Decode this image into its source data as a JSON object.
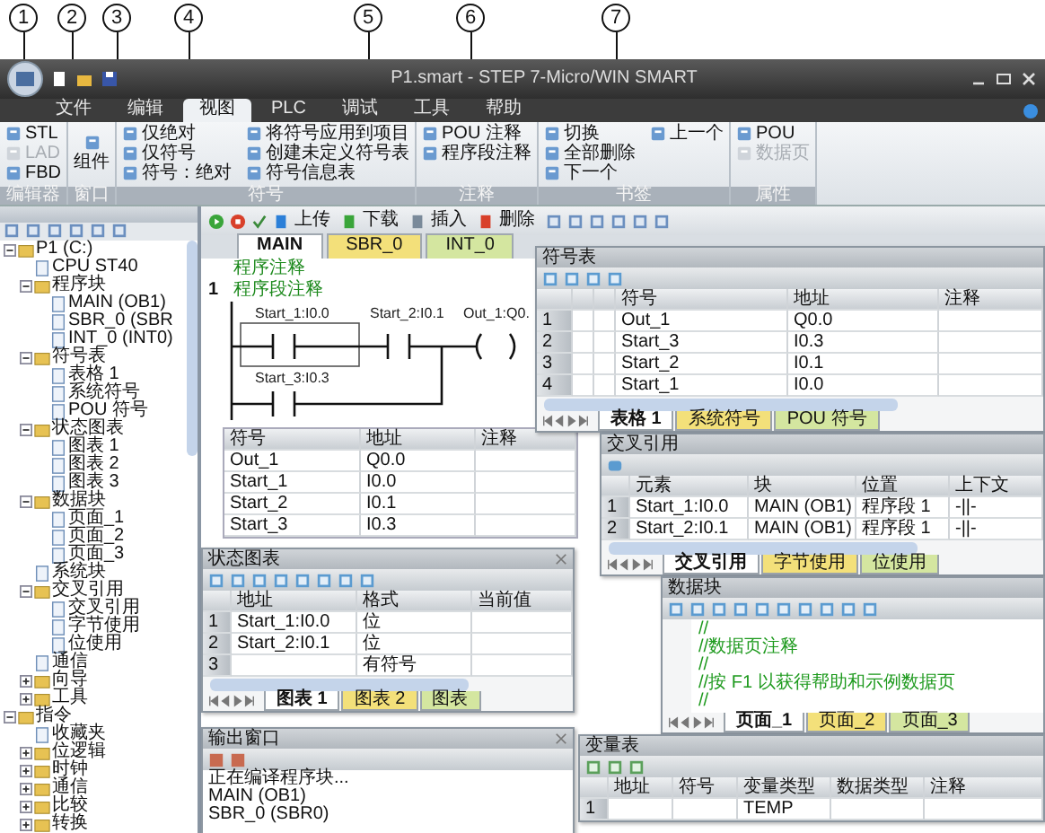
{
  "callouts": [
    "1",
    "2",
    "3",
    "4",
    "5",
    "6",
    "7"
  ],
  "window": {
    "title": "P1.smart - STEP 7-Micro/WIN SMART"
  },
  "ribbon_tabs": [
    {
      "label": "文件",
      "selected": false
    },
    {
      "label": "编辑",
      "selected": false
    },
    {
      "label": "视图",
      "selected": true
    },
    {
      "label": "PLC",
      "selected": false
    },
    {
      "label": "调试",
      "selected": false
    },
    {
      "label": "工具",
      "selected": false
    },
    {
      "label": "帮助",
      "selected": false
    }
  ],
  "ribbon_groups": [
    {
      "label": "编辑器",
      "items": [
        {
          "label": "STL",
          "disabled": false
        },
        {
          "label": "LAD",
          "disabled": true
        },
        {
          "label": "FBD",
          "disabled": false
        }
      ]
    },
    {
      "label": "窗口",
      "items": [
        {
          "label": "组件",
          "disabled": false
        }
      ]
    },
    {
      "label": "符号",
      "items": [
        {
          "label": "仅绝对",
          "disabled": false
        },
        {
          "label": "仅符号",
          "disabled": false
        },
        {
          "label": "符号：绝对",
          "disabled": false
        },
        {
          "label": "将符号应用到项目",
          "disabled": false
        },
        {
          "label": "创建未定义符号表",
          "disabled": false
        },
        {
          "label": "符号信息表",
          "disabled": false
        }
      ]
    },
    {
      "label": "注释",
      "items": [
        {
          "label": "POU 注释",
          "disabled": false
        },
        {
          "label": "程序段注释",
          "disabled": false
        }
      ]
    },
    {
      "label": "书签",
      "items": [
        {
          "label": "切换",
          "disabled": false
        },
        {
          "label": "全部删除",
          "disabled": false
        },
        {
          "label": "下一个",
          "disabled": false
        },
        {
          "label": "上一个",
          "disabled": false
        }
      ]
    },
    {
      "label": "属性",
      "items": [
        {
          "label": "POU",
          "disabled": false
        },
        {
          "label": "数据页",
          "disabled": true
        }
      ]
    }
  ],
  "tree": [
    {
      "label": "P1 (C:)",
      "expanded": true,
      "children": [
        {
          "label": "CPU ST40"
        },
        {
          "label": "程序块",
          "expanded": true,
          "children": [
            {
              "label": "MAIN (OB1)"
            },
            {
              "label": "SBR_0 (SBR"
            },
            {
              "label": "INT_0 (INT0)"
            }
          ]
        },
        {
          "label": "符号表",
          "expanded": true,
          "children": [
            {
              "label": "表格 1"
            },
            {
              "label": "系统符号"
            },
            {
              "label": "POU 符号"
            }
          ]
        },
        {
          "label": "状态图表",
          "expanded": true,
          "children": [
            {
              "label": "图表 1"
            },
            {
              "label": "图表 2"
            },
            {
              "label": "图表 3"
            }
          ]
        },
        {
          "label": "数据块",
          "expanded": true,
          "children": [
            {
              "label": "页面_1"
            },
            {
              "label": "页面_2"
            },
            {
              "label": "页面_3"
            }
          ]
        },
        {
          "label": "系统块"
        },
        {
          "label": "交叉引用",
          "expanded": true,
          "children": [
            {
              "label": "交叉引用"
            },
            {
              "label": "字节使用"
            },
            {
              "label": "位使用"
            }
          ]
        },
        {
          "label": "通信"
        },
        {
          "label": "向导",
          "expanded": false
        },
        {
          "label": "工具",
          "expanded": false
        }
      ]
    },
    {
      "label": "指令",
      "expanded": true,
      "children": [
        {
          "label": "收藏夹"
        },
        {
          "label": "位逻辑",
          "expanded": false
        },
        {
          "label": "时钟",
          "expanded": false
        },
        {
          "label": "通信",
          "expanded": false
        },
        {
          "label": "比较",
          "expanded": false
        },
        {
          "label": "转换",
          "expanded": false
        }
      ]
    }
  ],
  "editor": {
    "toolbar": [
      "上传",
      "下载",
      "插入",
      "删除"
    ],
    "tabs": [
      {
        "label": "MAIN",
        "selected": true,
        "color": "#ffffff"
      },
      {
        "label": "SBR_0",
        "selected": false,
        "color": "#f3e07a"
      },
      {
        "label": "INT_0",
        "selected": false,
        "color": "#d4e6a0"
      }
    ],
    "program_comment": "程序注释",
    "network": "1",
    "network_comment": "程序段注释",
    "ladder": {
      "contact_1": "Start_1:I0.0",
      "contact_2": "Start_2:I0.1",
      "coil": "Out_1:Q0.",
      "contact_3": "Start_3:I0.3"
    },
    "symbol_info": {
      "columns": [
        "符号",
        "地址",
        "注释"
      ],
      "rows": [
        {
          "symbol": "Out_1",
          "address": "Q0.0"
        },
        {
          "symbol": "Start_1",
          "address": "I0.0"
        },
        {
          "symbol": "Start_2",
          "address": "I0.1"
        },
        {
          "symbol": "Start_3",
          "address": "I0.3"
        }
      ]
    }
  },
  "symbol_table": {
    "title": "符号表",
    "columns": [
      "符号",
      "地址",
      "注释"
    ],
    "rows": [
      {
        "num": "1",
        "symbol": "Out_1",
        "address": "Q0.0"
      },
      {
        "num": "2",
        "symbol": "Start_3",
        "address": "I0.3"
      },
      {
        "num": "3",
        "symbol": "Start_2",
        "address": "I0.1"
      },
      {
        "num": "4",
        "symbol": "Start_1",
        "address": "I0.0"
      }
    ],
    "tabs": [
      {
        "label": "表格 1",
        "selected": true,
        "color": "#ffffff"
      },
      {
        "label": "系统符号",
        "selected": false,
        "color": "#f3e07a"
      },
      {
        "label": "POU 符号",
        "selected": false,
        "color": "#d4e6a0"
      }
    ]
  },
  "cross_reference": {
    "title": "交叉引用",
    "columns": [
      "元素",
      "块",
      "位置",
      "上下文"
    ],
    "rows": [
      {
        "num": "1",
        "element": "Start_1:I0.0",
        "block": "MAIN (OB1)",
        "location": "程序段 1",
        "context": "-||-"
      },
      {
        "num": "2",
        "element": "Start_2:I0.1",
        "block": "MAIN (OB1)",
        "location": "程序段 1",
        "context": "-||-"
      }
    ],
    "tabs": [
      {
        "label": "交叉引用",
        "selected": true,
        "color": "#ffffff"
      },
      {
        "label": "字节使用",
        "selected": false,
        "color": "#f3e07a"
      },
      {
        "label": "位使用",
        "selected": false,
        "color": "#d4e6a0"
      }
    ]
  },
  "status_chart": {
    "title": "状态图表",
    "columns": [
      "地址",
      "格式",
      "当前值"
    ],
    "rows": [
      {
        "num": "1",
        "address": "Start_1:I0.0",
        "format": "位"
      },
      {
        "num": "2",
        "address": "Start_2:I0.1",
        "format": "位"
      },
      {
        "num": "3",
        "format": "有符号"
      }
    ],
    "tabs": [
      {
        "label": "图表 1",
        "selected": true,
        "color": "#ffffff"
      },
      {
        "label": "图表 2",
        "selected": false,
        "color": "#f3e07a"
      },
      {
        "label": "图表",
        "selected": false,
        "color": "#d4e6a0"
      }
    ]
  },
  "output": {
    "title": "输出窗口",
    "lines": [
      "正在编译程序块...",
      "MAIN (OB1)",
      "SBR_0 (SBR0)"
    ]
  },
  "data_block": {
    "title": "数据块",
    "lines": [
      "//",
      "//数据页注释",
      "//",
      "//按 F1 以获得帮助和示例数据页",
      "//"
    ],
    "tabs": [
      {
        "label": "页面_1",
        "selected": true,
        "color": "#ffffff"
      },
      {
        "label": "页面_2",
        "selected": false,
        "color": "#f3e07a"
      },
      {
        "label": "页面_3",
        "selected": false,
        "color": "#d4e6a0"
      }
    ]
  },
  "variable_table": {
    "title": "变量表",
    "columns": [
      "地址",
      "符号",
      "变量类型",
      "数据类型",
      "注释"
    ],
    "rows": [
      {
        "num": "1",
        "var_type": "TEMP"
      }
    ]
  }
}
